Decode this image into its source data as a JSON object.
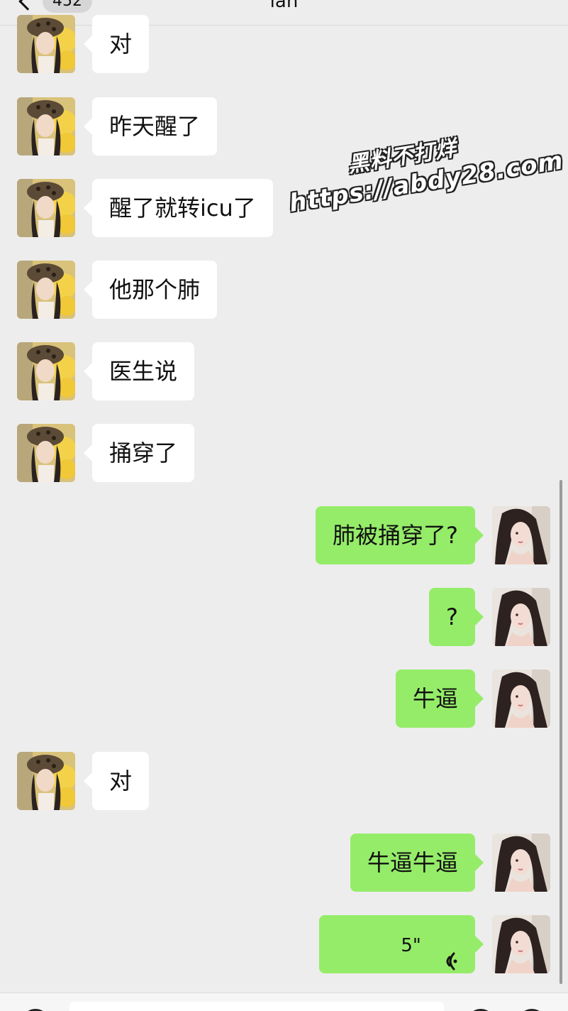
{
  "header": {
    "back_label": "",
    "unread_count": "452",
    "title": "lan"
  },
  "messages": [
    {
      "side": "in",
      "text": "对"
    },
    {
      "side": "in",
      "text": "昨天醒了"
    },
    {
      "side": "in",
      "text": "醒了就转icu了"
    },
    {
      "side": "in",
      "text": "他那个肺"
    },
    {
      "side": "in",
      "text": "医生说"
    },
    {
      "side": "in",
      "text": "捅穿了"
    },
    {
      "side": "out",
      "text": "肺被捅穿了?"
    },
    {
      "side": "out",
      "text": "?"
    },
    {
      "side": "out",
      "text": "牛逼"
    },
    {
      "side": "in",
      "text": "对"
    },
    {
      "side": "out",
      "text": "牛逼牛逼"
    },
    {
      "side": "out",
      "type": "voice",
      "duration": "5\""
    }
  ],
  "watermark": {
    "line1": "黑料不打烊",
    "line2": "https://abdy28.com"
  },
  "colors": {
    "background": "#ededed",
    "incoming_bubble": "#ffffff",
    "outgoing_bubble": "#95ec69"
  },
  "icons": [
    "back-chevron-icon",
    "voice-wave-icon",
    "voice-input-icon",
    "emoji-icon",
    "plus-icon"
  ]
}
